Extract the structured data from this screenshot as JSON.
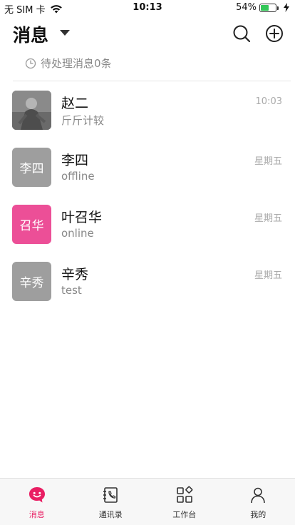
{
  "status_bar": {
    "carrier": "无 SIM 卡",
    "time": "10:13",
    "battery_percent": "54%",
    "battery_level": 0.54
  },
  "header": {
    "title": "消息",
    "search_icon": "search-icon",
    "add_icon": "plus-circle-icon"
  },
  "pending": {
    "text": "待处理消息0条",
    "icon": "clock-icon"
  },
  "conversations": [
    {
      "name": "赵二",
      "message": "斤斤计较",
      "time": "10:03",
      "avatar_text": "",
      "avatar_color": "#6f6f6f",
      "avatar_type": "image"
    },
    {
      "name": "李四",
      "message": "offline",
      "time": "星期五",
      "avatar_text": "李四",
      "avatar_color": "#9e9e9e",
      "avatar_type": "text"
    },
    {
      "name": "叶召华",
      "message": "online",
      "time": "星期五",
      "avatar_text": "召华",
      "avatar_color": "#ec4f97",
      "avatar_type": "text"
    },
    {
      "name": "辛秀",
      "message": "test",
      "time": "星期五",
      "avatar_text": "辛秀",
      "avatar_color": "#9e9e9e",
      "avatar_type": "text"
    }
  ],
  "tabbar": {
    "tabs": [
      {
        "label": "消息",
        "icon": "chat-bubble-icon",
        "active": true
      },
      {
        "label": "通讯录",
        "icon": "contacts-book-icon",
        "active": false
      },
      {
        "label": "工作台",
        "icon": "grid-apps-icon",
        "active": false
      },
      {
        "label": "我的",
        "icon": "user-icon",
        "active": false
      }
    ]
  },
  "colors": {
    "accent": "#e91e63",
    "battery": "#34c759"
  }
}
